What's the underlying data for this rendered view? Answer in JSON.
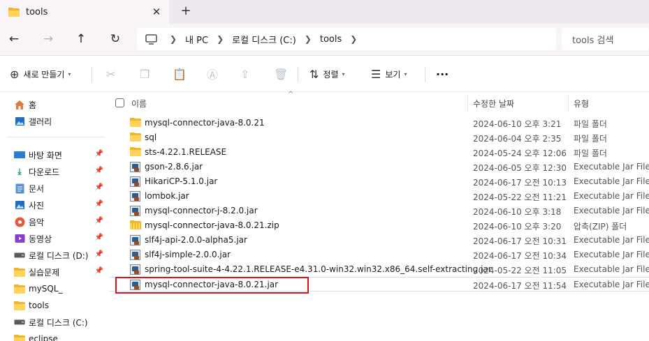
{
  "tab": {
    "title": "tools",
    "close": "✕",
    "new": "+"
  },
  "nav": {
    "back": "←",
    "forward": "→",
    "up": "↑",
    "refresh": "↻",
    "breadcrumb": [
      "내 PC",
      "로컬 디스크 (C:)",
      "tools"
    ],
    "search_placeholder": "tools 검색"
  },
  "commands": {
    "new_label": "새로 만들기",
    "sort_label": "정렬",
    "view_label": "보기",
    "more": "···"
  },
  "sidebar": {
    "items": [
      {
        "label": "홈",
        "icon": "home-icon"
      },
      {
        "label": "갤러리",
        "icon": "gallery-icon"
      },
      {
        "label": "바탕 화면",
        "icon": "desktop-icon",
        "pinned": true
      },
      {
        "label": "다운로드",
        "icon": "download-icon",
        "pinned": true
      },
      {
        "label": "문서",
        "icon": "document-icon",
        "pinned": true
      },
      {
        "label": "사진",
        "icon": "pictures-icon",
        "pinned": true
      },
      {
        "label": "음악",
        "icon": "music-icon",
        "pinned": true
      },
      {
        "label": "동영상",
        "icon": "video-icon",
        "pinned": true
      },
      {
        "label": "로컬 디스크 (D:)",
        "icon": "drive-icon",
        "pinned": true
      },
      {
        "label": "실습문제",
        "icon": "folder-icon",
        "pinned": true
      },
      {
        "label": "mySQL_",
        "icon": "folder-icon"
      },
      {
        "label": "tools",
        "icon": "folder-icon"
      },
      {
        "label": "로컬 디스크 (C:)",
        "icon": "drive-icon"
      },
      {
        "label": "eclipse",
        "icon": "folder-icon"
      }
    ]
  },
  "columns": {
    "name": "이름",
    "date": "수정한 날짜",
    "type": "유형"
  },
  "files": [
    {
      "name": "mysql-connector-java-8.0.21",
      "date": "2024-06-10 오후 3:21",
      "type": "파일 폴더",
      "kind": "folder"
    },
    {
      "name": "sql",
      "date": "2024-06-04 오후 2:35",
      "type": "파일 폴더",
      "kind": "folder"
    },
    {
      "name": "sts-4.22.1.RELEASE",
      "date": "2024-05-24 오후 12:06",
      "type": "파일 폴더",
      "kind": "folder"
    },
    {
      "name": "gson-2.8.6.jar",
      "date": "2024-06-05 오후 12:30",
      "type": "Executable Jar File",
      "kind": "jar"
    },
    {
      "name": "HikariCP-5.1.0.jar",
      "date": "2024-06-17 오전 10:13",
      "type": "Executable Jar File",
      "kind": "jar"
    },
    {
      "name": "lombok.jar",
      "date": "2024-05-22 오전 11:21",
      "type": "Executable Jar File",
      "kind": "jar"
    },
    {
      "name": "mysql-connector-j-8.2.0.jar",
      "date": "2024-06-10 오후 3:18",
      "type": "Executable Jar File",
      "kind": "jar"
    },
    {
      "name": "mysql-connector-java-8.0.21.zip",
      "date": "2024-06-10 오후 3:20",
      "type": "압축(ZIP) 폴더",
      "kind": "zip"
    },
    {
      "name": "slf4j-api-2.0.0-alpha5.jar",
      "date": "2024-06-17 오전 10:31",
      "type": "Executable Jar File",
      "kind": "jar"
    },
    {
      "name": "slf4j-simple-2.0.0.jar",
      "date": "2024-06-17 오전 10:34",
      "type": "Executable Jar File",
      "kind": "jar"
    },
    {
      "name": "spring-tool-suite-4-4.22.1.RELEASE-e4.31.0-win32.win32.x86_64.self-extracting.jar",
      "date": "2024-05-22 오전 11:05",
      "type": "Executable Jar File",
      "kind": "jar"
    },
    {
      "name": "mysql-connector-java-8.0.21.jar",
      "date": "2024-06-17 오전 11:54",
      "type": "Executable Jar File",
      "kind": "jar"
    }
  ],
  "colors": {
    "highlight": "#e2121a",
    "folder": "#ffd35c",
    "accent": "#0067c0"
  }
}
